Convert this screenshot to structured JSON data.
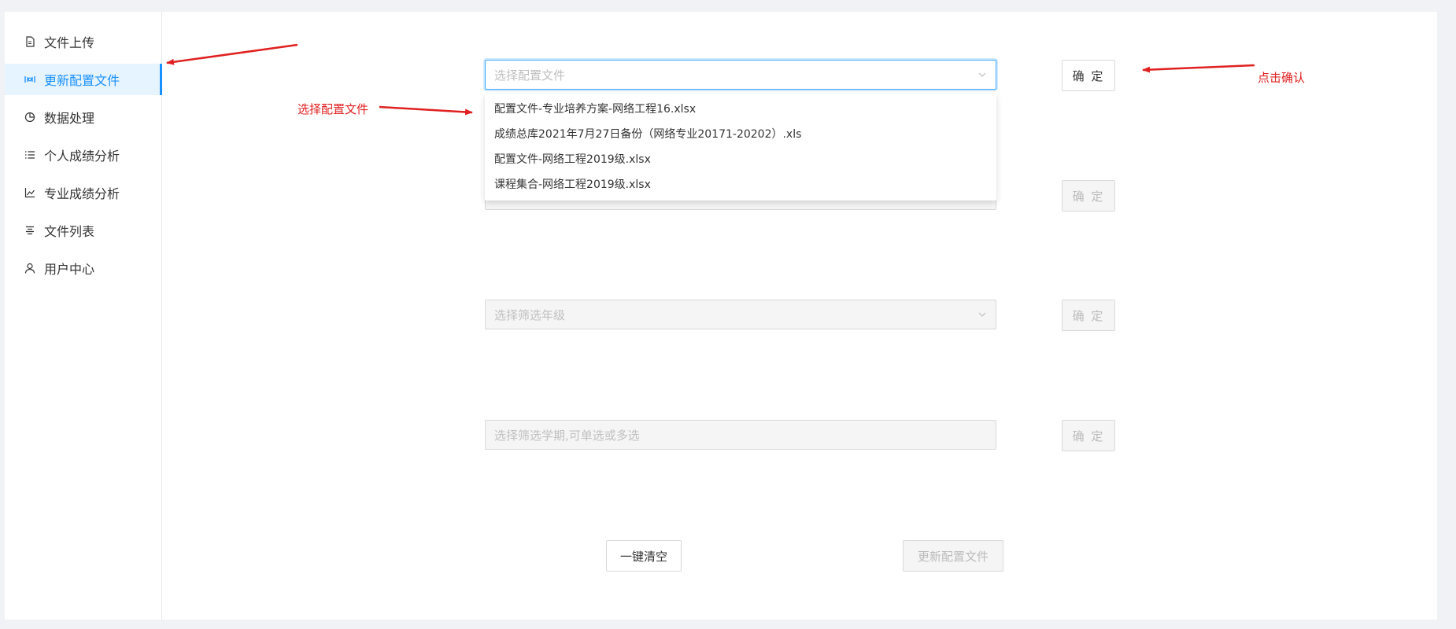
{
  "sidebar": {
    "items": [
      {
        "label": "文件上传",
        "icon": "file-icon",
        "active": false
      },
      {
        "label": "更新配置文件",
        "icon": "config-icon",
        "active": true
      },
      {
        "label": "数据处理",
        "icon": "pie-icon",
        "active": false
      },
      {
        "label": "个人成绩分析",
        "icon": "list-icon",
        "active": false
      },
      {
        "label": "专业成绩分析",
        "icon": "line-chart-icon",
        "active": false
      },
      {
        "label": "文件列表",
        "icon": "align-icon",
        "active": false
      },
      {
        "label": "用户中心",
        "icon": "user-icon",
        "active": false
      }
    ]
  },
  "form": {
    "config_select": {
      "placeholder": "选择配置文件",
      "state": "focused"
    },
    "second_select": {
      "placeholder": "",
      "state": "disabled"
    },
    "grade_select": {
      "placeholder": "选择筛选年级",
      "state": "disabled"
    },
    "semester_select": {
      "placeholder": "选择筛选学期,可单选或多选",
      "state": "disabled"
    },
    "confirm_label": "确 定",
    "clear_label": "一键清空",
    "update_label": "更新配置文件"
  },
  "dropdown": {
    "options": [
      "配置文件-专业培养方案-网络工程16.xlsx",
      "成绩总库2021年7月27日备份（网络专业20171-20202）.xls",
      "配置文件-网络工程2019级.xlsx",
      "课程集合-网络工程2019级.xlsx"
    ]
  },
  "annotations": {
    "select_config": "选择配置文件",
    "click_confirm": "点击确认"
  },
  "colors": {
    "accent": "#1890ff",
    "annotation": "#e02020"
  }
}
